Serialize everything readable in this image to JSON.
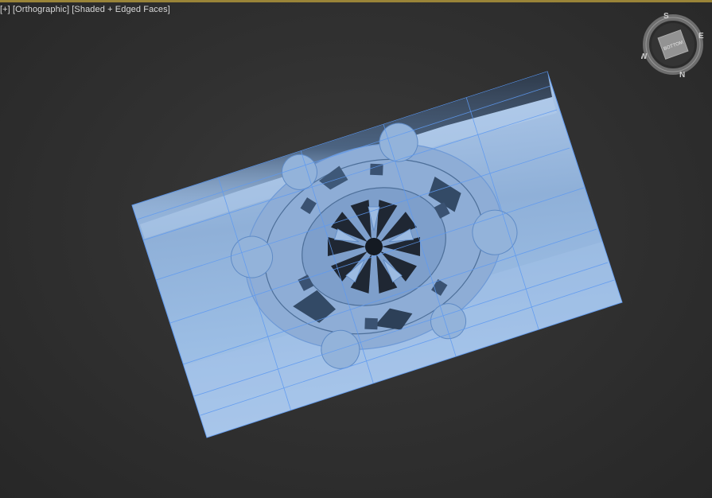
{
  "viewport": {
    "labels": {
      "plus": "[+]",
      "view": "[Orthographic]",
      "shading": "[Shaded + Edged Faces]"
    },
    "colors": {
      "background": "#2f2f2f",
      "active_border": "#9a8438",
      "mesh_fill": "#8fb2dc",
      "mesh_edges": "#5f9af0"
    }
  },
  "viewcube": {
    "face_label": "BOTTOM",
    "compass": {
      "north": "N",
      "south": "S",
      "east": "E",
      "west": "W"
    }
  }
}
